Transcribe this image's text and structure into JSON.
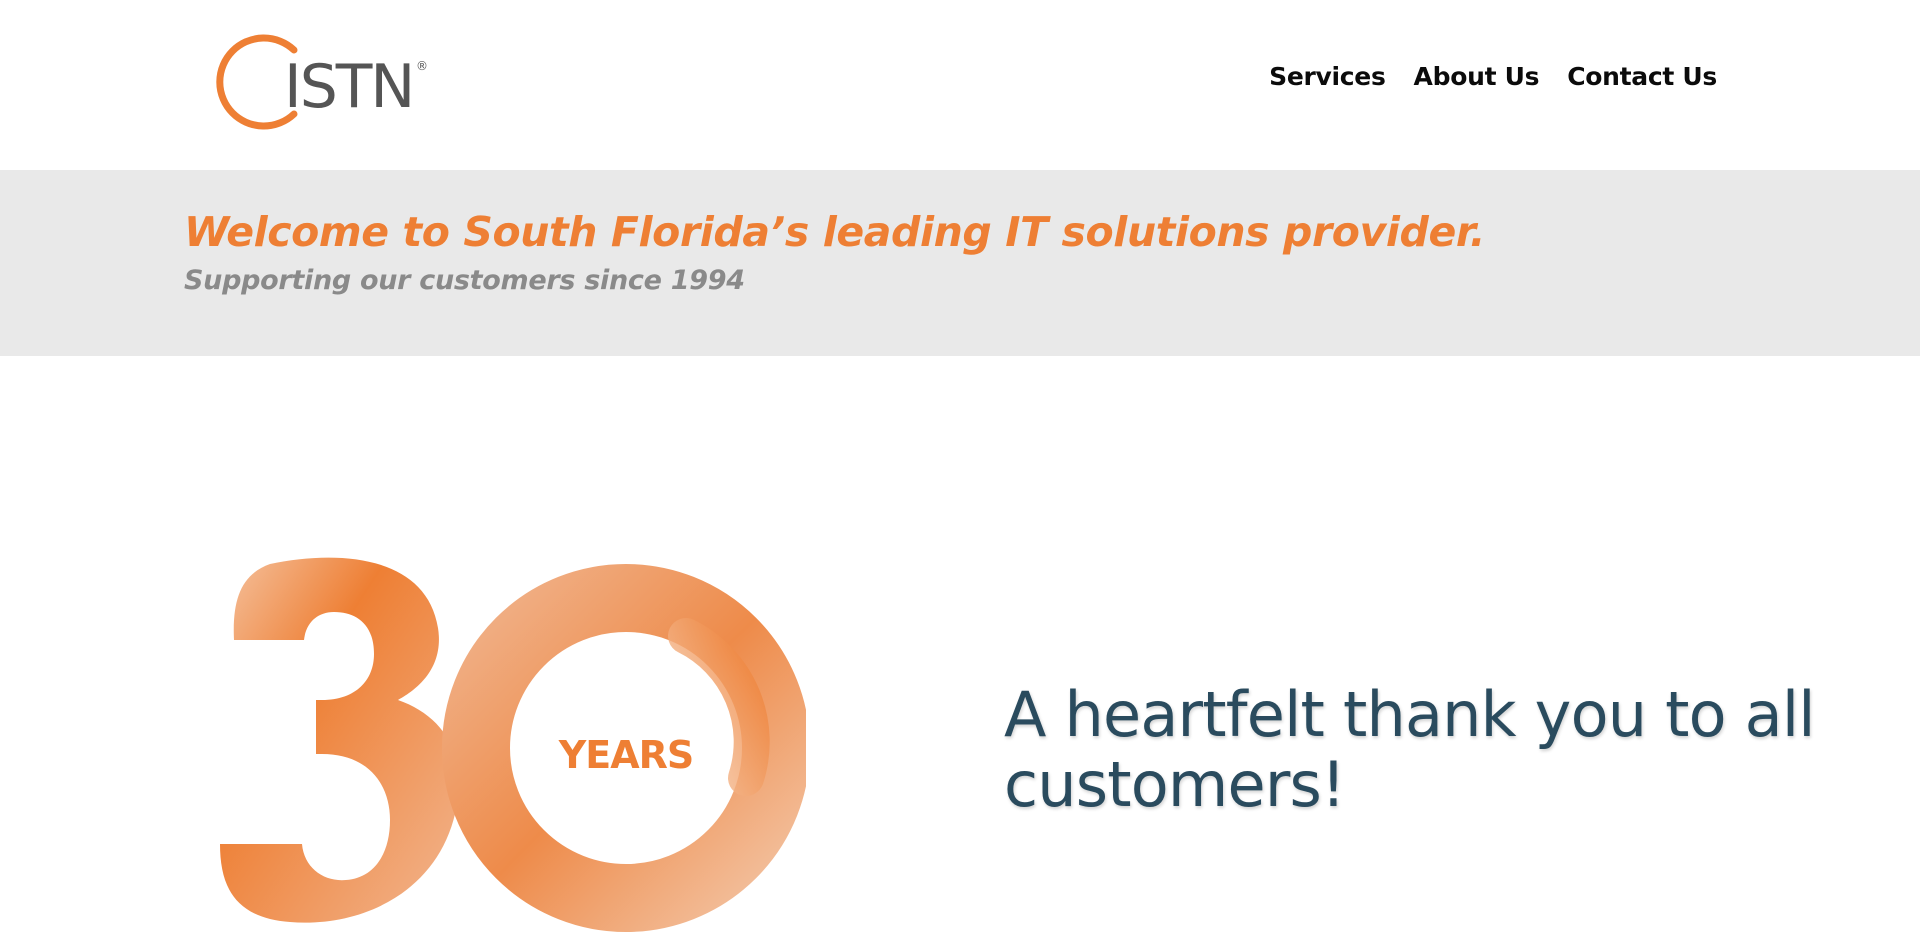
{
  "brand": {
    "logo_text": "ISTN",
    "logo_mark": "®",
    "accent_color": "#ee7f34",
    "logo_text_color": "#555555"
  },
  "nav": {
    "items": [
      {
        "label": "Services"
      },
      {
        "label": "About Us"
      },
      {
        "label": "Contact Us"
      }
    ]
  },
  "banner": {
    "title": "Welcome to South Florida’s leading IT solutions provider.",
    "subtitle": "Supporting our customers since 1994",
    "background_color": "#e9e9e9"
  },
  "anniversary": {
    "number": "30",
    "label": "YEARS"
  },
  "message": {
    "text": "A heartfelt thank you to all customers!",
    "color": "#2a4b5e"
  }
}
